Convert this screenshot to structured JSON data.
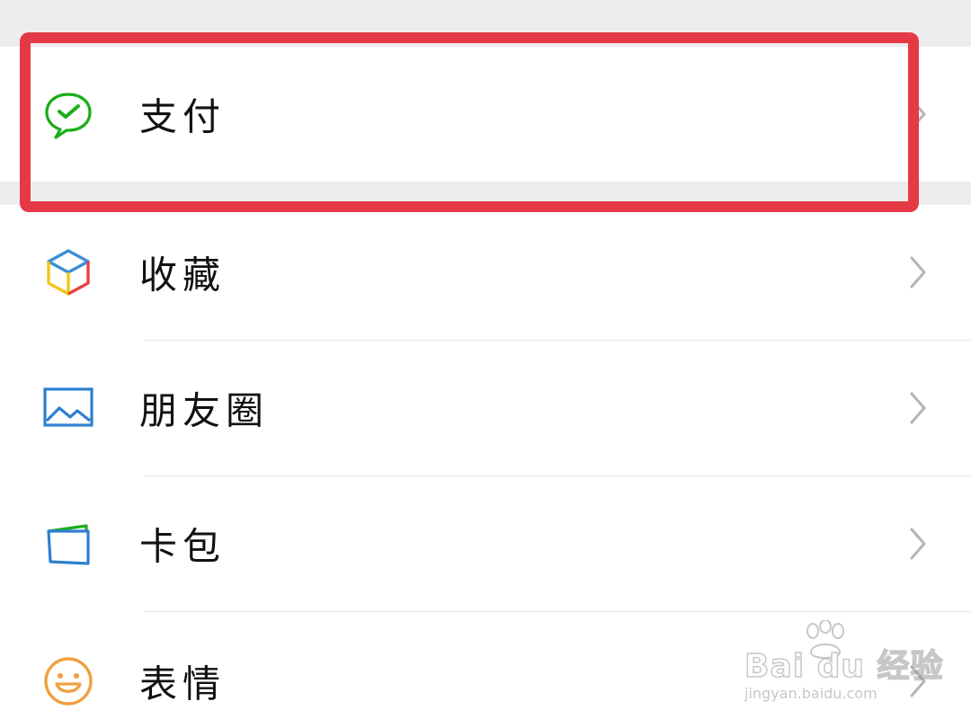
{
  "menu": {
    "items": [
      {
        "label": "支付",
        "icon": "wechat-pay-check-icon",
        "icon_color": "#1aad19",
        "highlighted": true
      },
      {
        "label": "收藏",
        "icon": "favorites-cube-icon",
        "icon_colors": [
          "#3b8fd6",
          "#f5c518",
          "#e64340"
        ]
      },
      {
        "label": "朋友圈",
        "icon": "moments-picture-icon",
        "icon_color": "#2e7fd0"
      },
      {
        "label": "卡包",
        "icon": "card-wallet-icon",
        "icon_colors": [
          "#2e7fd0",
          "#1aad19"
        ]
      },
      {
        "label": "表情",
        "icon": "smiley-face-icon",
        "icon_color": "#f0a040"
      }
    ]
  },
  "highlight": {
    "color": "#e53945"
  },
  "watermark": {
    "brand": "Bai du 经验",
    "url": "jingyan.baidu.com"
  },
  "colors": {
    "background": "#ffffff",
    "section_gap": "#ededed",
    "divider": "#e3e3e3",
    "chevron": "#b5b5b5",
    "text": "#111111"
  }
}
